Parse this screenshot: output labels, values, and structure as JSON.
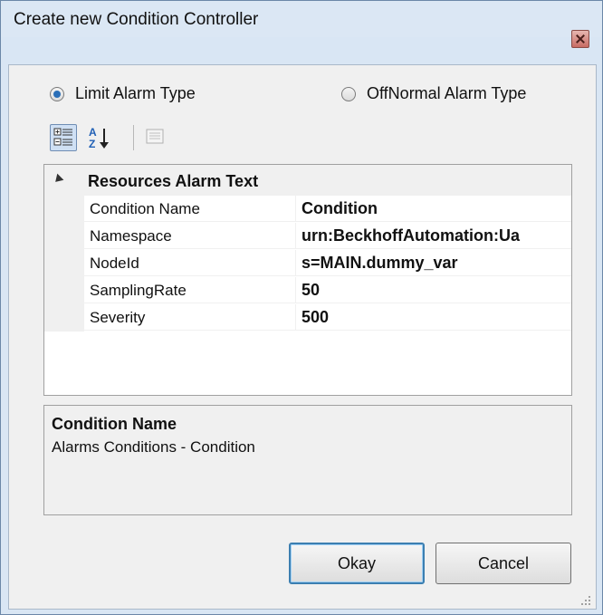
{
  "window": {
    "title": "Create new Condition Controller",
    "close_icon": "close-icon"
  },
  "alarm_type": {
    "options": [
      {
        "label": "Limit Alarm Type",
        "selected": true
      },
      {
        "label": "OffNormal Alarm Type",
        "selected": false
      }
    ]
  },
  "toolbar": {
    "buttons": [
      {
        "icon": "categorized-view-icon",
        "active": true
      },
      {
        "icon": "alphabetical-sort-icon",
        "active": false
      },
      {
        "icon": "property-pages-icon",
        "active": false
      }
    ]
  },
  "property_grid": {
    "category": "Resources Alarm Text",
    "rows": [
      {
        "name": "Condition Name",
        "value": "Condition"
      },
      {
        "name": "Namespace",
        "value": "urn:BeckhoffAutomation:Ua"
      },
      {
        "name": "NodeId",
        "value": "s=MAIN.dummy_var"
      },
      {
        "name": "SamplingRate",
        "value": "50"
      },
      {
        "name": "Severity",
        "value": "500"
      }
    ]
  },
  "description": {
    "title": "Condition Name",
    "text": "Alarms  Conditions - Condition"
  },
  "buttons": {
    "okay": "Okay",
    "cancel": "Cancel"
  }
}
